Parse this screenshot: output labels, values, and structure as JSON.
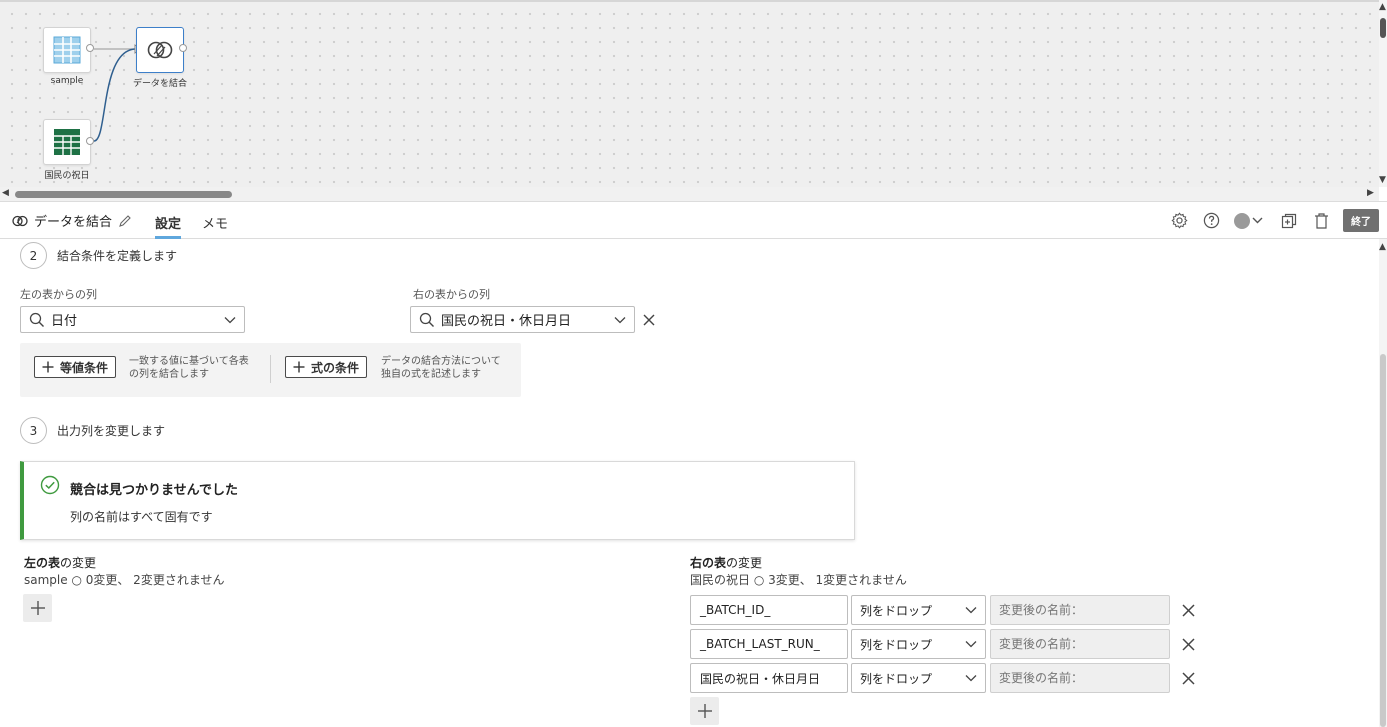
{
  "canvas": {
    "nodes": [
      {
        "label": "sample",
        "icon": "table-icon"
      },
      {
        "label": "データを結合",
        "icon": "join-icon"
      },
      {
        "label": "国民の祝日",
        "icon": "excel-icon"
      }
    ]
  },
  "panel": {
    "title": "データを結合",
    "tabs": [
      "設定",
      "メモ"
    ],
    "active_tab": "設定",
    "finish_label": "終了"
  },
  "step2": {
    "number": "2",
    "title": "結合条件を定義します",
    "left_label": "左の表からの列",
    "left_value": "日付",
    "right_label": "右の表からの列",
    "right_value": "国民の祝日・休日月日",
    "equal_button": "等値条件",
    "equal_desc_1": "一致する値に基づいて各表",
    "equal_desc_2": "の列を結合します",
    "expr_button": "式の条件",
    "expr_desc_1": "データの結合方法について",
    "expr_desc_2": "独自の式を記述します"
  },
  "step3": {
    "number": "3",
    "title": "出力列を変更します",
    "notice_title": "競合は見つかりませんでした",
    "notice_text": "列の名前はすべて固有です"
  },
  "left_changes": {
    "title_bold": "左の表",
    "title_rest": "の変更",
    "summary": "sample ○ 0変更、 2変更されません"
  },
  "right_changes": {
    "title_bold": "右の表",
    "title_rest": "の変更",
    "summary": "国民の祝日 ○ 3変更、 1変更されません",
    "rows": [
      {
        "column": "_BATCH_ID_",
        "action": "列をドロップ",
        "rename_placeholder": "変更後の名前："
      },
      {
        "column": "_BATCH_LAST_RUN_",
        "action": "列をドロップ",
        "rename_placeholder": "変更後の名前："
      },
      {
        "column": "国民の祝日・休日月日",
        "action": "列をドロップ",
        "rename_placeholder": "変更後の名前："
      }
    ]
  },
  "colors": {
    "accent": "#5fa7dd",
    "success": "#3f9a3f",
    "excel_green": "#1e7145",
    "selection_blue": "#3d7fc9"
  }
}
